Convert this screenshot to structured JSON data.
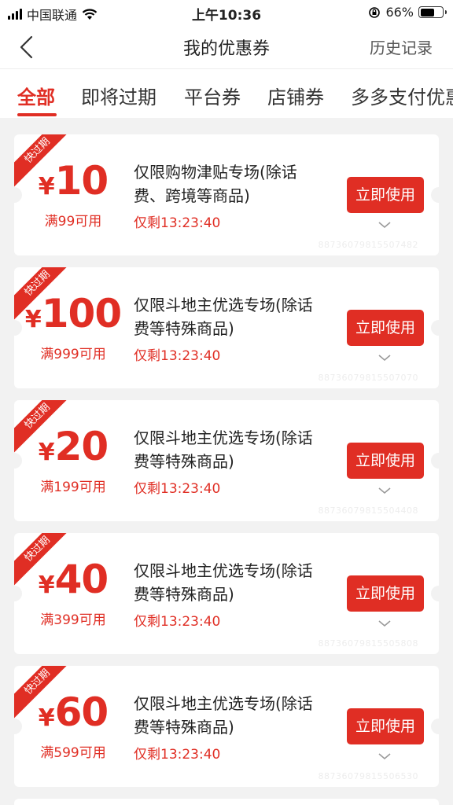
{
  "status_bar": {
    "carrier": "中国联通",
    "time": "上午10:36",
    "battery": "66%"
  },
  "nav": {
    "title": "我的优惠券",
    "history": "历史记录"
  },
  "tabs": [
    {
      "label": "全部"
    },
    {
      "label": "即将过期"
    },
    {
      "label": "平台券"
    },
    {
      "label": "店铺券"
    },
    {
      "label": "多多支付优惠"
    }
  ],
  "coupons": [
    {
      "badge": "快过期",
      "currency": "¥",
      "amount": "10",
      "condition": "满99可用",
      "description": "仅限购物津贴专场(除话费、跨境等商品)",
      "remaining": "仅剩13:23:40",
      "button": "立即使用",
      "code": "88736079815507482"
    },
    {
      "badge": "快过期",
      "currency": "¥",
      "amount": "100",
      "condition": "满999可用",
      "description": "仅限斗地主优选专场(除话费等特殊商品)",
      "remaining": "仅剩13:23:40",
      "button": "立即使用",
      "code": "88736079815507070"
    },
    {
      "badge": "快过期",
      "currency": "¥",
      "amount": "20",
      "condition": "满199可用",
      "description": "仅限斗地主优选专场(除话费等特殊商品)",
      "remaining": "仅剩13:23:40",
      "button": "立即使用",
      "code": "88736079815504408"
    },
    {
      "badge": "快过期",
      "currency": "¥",
      "amount": "40",
      "condition": "满399可用",
      "description": "仅限斗地主优选专场(除话费等特殊商品)",
      "remaining": "仅剩13:23:40",
      "button": "立即使用",
      "code": "88736079815505808"
    },
    {
      "badge": "快过期",
      "currency": "¥",
      "amount": "60",
      "condition": "满599可用",
      "description": "仅限斗地主优选专场(除话费等特殊商品)",
      "remaining": "仅剩13:23:40",
      "button": "立即使用",
      "code": "88736079815506530"
    }
  ]
}
